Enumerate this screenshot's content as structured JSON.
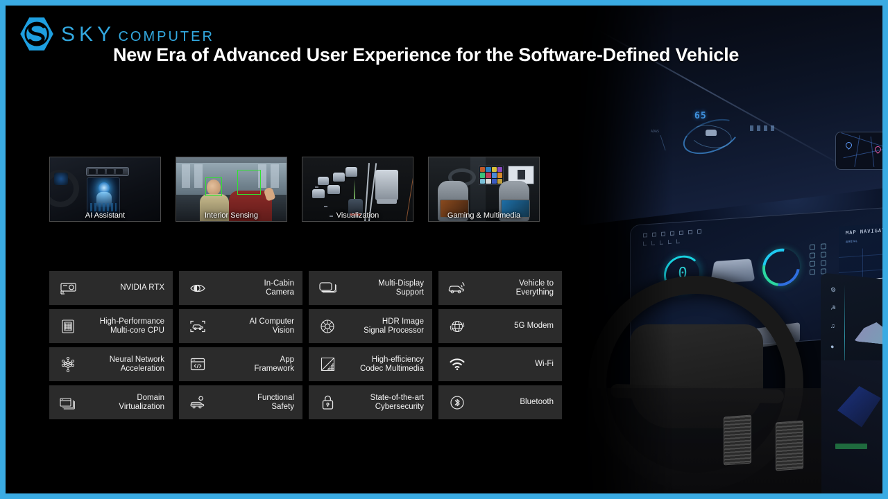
{
  "slide": {
    "border_color": "#3aabe3",
    "background_color": "#000000",
    "accent_color": "#33a9e0"
  },
  "header": {
    "logo": {
      "mark_name": "sky-computer-hexagon-s-logo",
      "line1": "SKY",
      "line2": "COMPUTER",
      "color": "#33a9e0"
    },
    "title": "New Era of Advanced User Experience for the Software-Defined Vehicle"
  },
  "cards": [
    {
      "caption": "AI Assistant",
      "image_name": "ai-assistant-dashboard-photo"
    },
    {
      "caption": "Interior Sensing",
      "image_name": "interior-sensing-occupants-photo"
    },
    {
      "caption": "Visualization",
      "image_name": "visualization-traffic-render"
    },
    {
      "caption": "Gaming & Multimedia",
      "image_name": "gaming-multimedia-cabin-photo"
    }
  ],
  "features": [
    {
      "label": "NVIDIA RTX",
      "icon": "gpu-card-icon"
    },
    {
      "label": "In-Cabin\nCamera",
      "icon": "eye-camera-icon"
    },
    {
      "label": "Multi-Display\nSupport",
      "icon": "stacked-displays-icon"
    },
    {
      "label": "Vehicle to\nEverything",
      "icon": "car-signal-icon"
    },
    {
      "label": "High-Performance\nMulti-core CPU",
      "icon": "cpu-chip-icon"
    },
    {
      "label": "AI Computer\nVision",
      "icon": "car-detection-frame-icon"
    },
    {
      "label": "HDR Image\nSignal Processor",
      "icon": "camera-aperture-icon"
    },
    {
      "label": "5G Modem",
      "icon": "globe-network-icon"
    },
    {
      "label": "Neural Network\nAcceleration",
      "icon": "neural-network-icon"
    },
    {
      "label": "App\nFramework",
      "icon": "code-window-icon"
    },
    {
      "label": "High-efficiency\nCodec Multimedia",
      "icon": "codec-gradient-icon"
    },
    {
      "label": "Wi-Fi",
      "icon": "wifi-icon"
    },
    {
      "label": "Domain\nVirtualization",
      "icon": "stacked-windows-icon"
    },
    {
      "label": "Functional\nSafety",
      "icon": "car-gear-safety-icon"
    },
    {
      "label": "State-of-the-art\nCybersecurity",
      "icon": "padlock-icon"
    },
    {
      "label": "Bluetooth",
      "icon": "bluetooth-icon"
    }
  ],
  "background_scene": {
    "name": "software-defined-vehicle-cockpit",
    "hud_speed": "65",
    "cluster_value": "0",
    "map_panel_title": "MAP NAVIGATION"
  }
}
